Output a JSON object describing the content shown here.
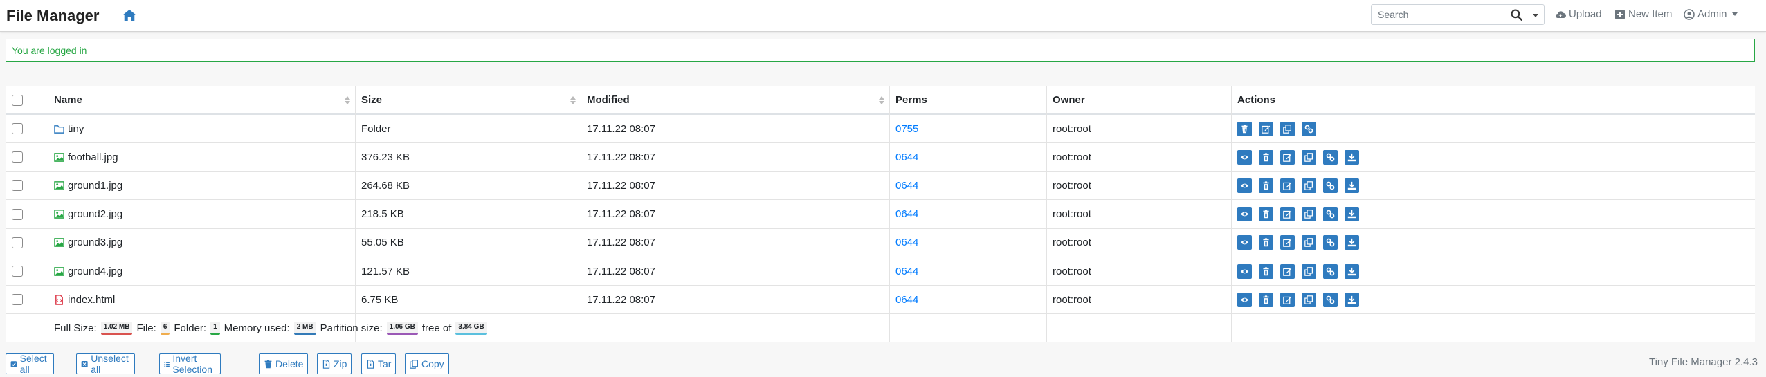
{
  "navbar": {
    "brand": "File Manager",
    "search_placeholder": "Search",
    "upload_label": "Upload",
    "new_item_label": "New Item",
    "admin_label": "Admin"
  },
  "alert": {
    "message": "You are logged in"
  },
  "table": {
    "headers": {
      "name": "Name",
      "size": "Size",
      "modified": "Modified",
      "perms": "Perms",
      "owner": "Owner",
      "actions": "Actions"
    },
    "rows": [
      {
        "name": "tiny",
        "type": "folder",
        "size": "Folder",
        "modified": "17.11.22 08:07",
        "perms": "0755",
        "owner": "root:root",
        "actions": [
          "delete",
          "rename",
          "copy",
          "link"
        ]
      },
      {
        "name": "football.jpg",
        "type": "image",
        "size": "376.23 KB",
        "modified": "17.11.22 08:07",
        "perms": "0644",
        "owner": "root:root",
        "actions": [
          "view",
          "delete",
          "rename",
          "copy",
          "link",
          "download"
        ]
      },
      {
        "name": "ground1.jpg",
        "type": "image",
        "size": "264.68 KB",
        "modified": "17.11.22 08:07",
        "perms": "0644",
        "owner": "root:root",
        "actions": [
          "view",
          "delete",
          "rename",
          "copy",
          "link",
          "download"
        ]
      },
      {
        "name": "ground2.jpg",
        "type": "image",
        "size": "218.5 KB",
        "modified": "17.11.22 08:07",
        "perms": "0644",
        "owner": "root:root",
        "actions": [
          "view",
          "delete",
          "rename",
          "copy",
          "link",
          "download"
        ]
      },
      {
        "name": "ground3.jpg",
        "type": "image",
        "size": "55.05 KB",
        "modified": "17.11.22 08:07",
        "perms": "0644",
        "owner": "root:root",
        "actions": [
          "view",
          "delete",
          "rename",
          "copy",
          "link",
          "download"
        ]
      },
      {
        "name": "ground4.jpg",
        "type": "image",
        "size": "121.57 KB",
        "modified": "17.11.22 08:07",
        "perms": "0644",
        "owner": "root:root",
        "actions": [
          "view",
          "delete",
          "rename",
          "copy",
          "link",
          "download"
        ]
      },
      {
        "name": "index.html",
        "type": "html",
        "size": "6.75 KB",
        "modified": "17.11.22 08:07",
        "perms": "0644",
        "owner": "root:root",
        "actions": [
          "view",
          "delete",
          "rename",
          "copy",
          "link",
          "download"
        ]
      }
    ],
    "summary": {
      "full_size_label": "Full Size:",
      "full_size": "1.02 MB",
      "file_label": "File:",
      "file_count": "6",
      "folder_label": "Folder:",
      "folder_count": "1",
      "memory_label": "Memory used:",
      "memory": "2 MB",
      "partition_label": "Partition size:",
      "partition": "1.06 GB",
      "free_label": "free of",
      "total": "3.84 GB"
    }
  },
  "buttons": {
    "select_all": "Select all",
    "unselect_all": "Unselect all",
    "invert_selection": "Invert Selection",
    "delete": "Delete",
    "zip": "Zip",
    "tar": "Tar",
    "copy": "Copy"
  },
  "version": "Tiny File Manager 2.4.3",
  "colors": {
    "accent": "#2f7bbf",
    "link": "#007bff",
    "success": "#28a745",
    "badge_full": "#d9534f",
    "badge_file": "#f0ad4e",
    "badge_folder": "#28a745",
    "badge_memory": "#337ab7",
    "badge_partition": "#9b59b6",
    "badge_total": "#5bc0de"
  }
}
